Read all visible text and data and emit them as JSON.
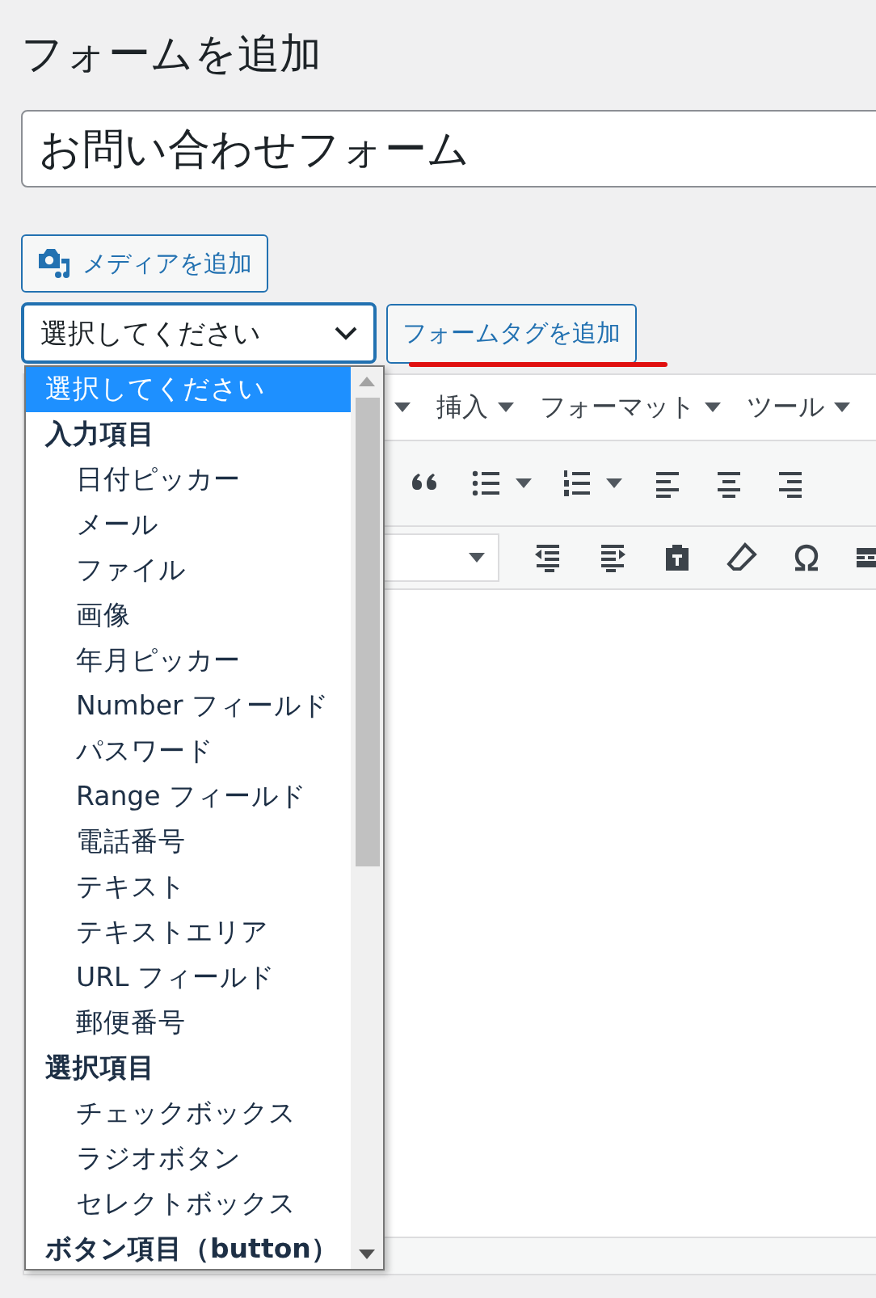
{
  "page_title": "フォームを追加",
  "form_title": {
    "value": "お問い合わせフォーム"
  },
  "media_button": {
    "label": "メディアを追加"
  },
  "tag_select": {
    "value": "選択してください",
    "focused": true
  },
  "add_tag_button": {
    "label": "フォームタグを追加",
    "underlined": true
  },
  "dropdown": {
    "items": [
      {
        "kind": "option",
        "label": "選択してください",
        "selected": true
      },
      {
        "kind": "group",
        "label": "入力項目",
        "children": [
          {
            "label": "日付ピッカー",
            "selected": false
          },
          {
            "label": "メール",
            "selected": false
          },
          {
            "label": "ファイル",
            "selected": false
          },
          {
            "label": "画像",
            "selected": false
          },
          {
            "label": "年月ピッカー",
            "selected": false
          },
          {
            "label": "Number フィールド",
            "selected": false
          },
          {
            "label": "パスワード",
            "selected": false
          },
          {
            "label": "Range フィールド",
            "selected": false
          },
          {
            "label": "電話番号",
            "selected": false
          },
          {
            "label": "テキスト",
            "selected": false
          },
          {
            "label": "テキストエリア",
            "selected": false
          },
          {
            "label": "URL フィールド",
            "selected": false
          },
          {
            "label": "郵便番号",
            "selected": false
          }
        ]
      },
      {
        "kind": "group",
        "label": "選択項目",
        "children": [
          {
            "label": "チェックボックス",
            "selected": false
          },
          {
            "label": "ラジオボタン",
            "selected": false
          },
          {
            "label": "セレクトボックス",
            "selected": false
          }
        ]
      },
      {
        "kind": "group",
        "label": "ボタン項目（button）"
      }
    ]
  },
  "editor": {
    "menus": [
      {
        "label": "挿入"
      },
      {
        "label": "フォーマット"
      },
      {
        "label": "ツール"
      }
    ]
  }
}
